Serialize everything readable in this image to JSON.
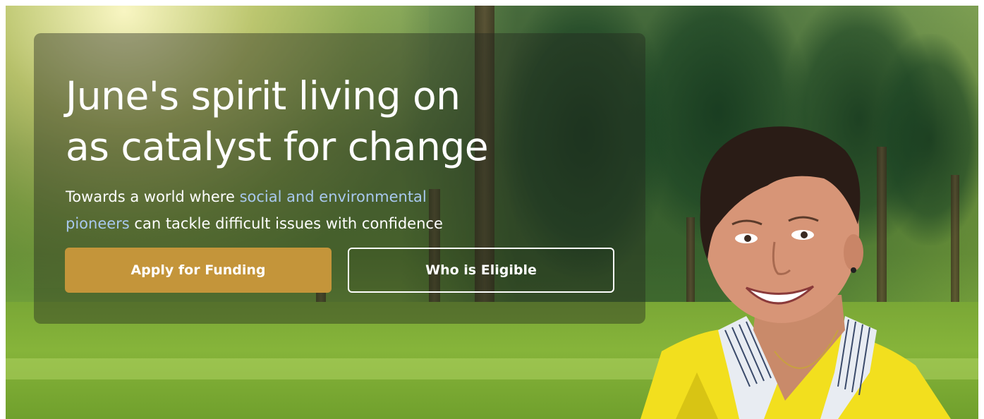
{
  "hero": {
    "headline_line1": "June's spirit living on",
    "headline_line2": "as catalyst for change",
    "sub_part1": "Towards a world where ",
    "sub_accent1": "social and environmental",
    "sub_accent2": "pioneers",
    "sub_part2": " can tackle difficult issues with confidence",
    "accent_color": "#a8c8ee",
    "button_color": "#c4953a"
  },
  "buttons": {
    "apply_label": "Apply for Funding",
    "eligible_label": "Who is Eligible"
  }
}
